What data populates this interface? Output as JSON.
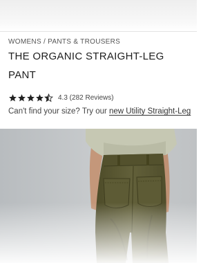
{
  "breadcrumb": "WOMENS / PANTS & TROUSERS",
  "product": {
    "title_line1": "THE ORGANIC STRAIGHT-LEG",
    "title_line2": "PANT",
    "rating": 4.3,
    "rating_text": "4.3 (282 Reviews)",
    "stars_filled": 4,
    "stars_half": 1
  },
  "size_help": {
    "prefix": "Can't find your size? Try our ",
    "link": "new Utility Straight-Leg"
  },
  "colors": {
    "pant_olive": "#5b5a33",
    "shirt_sage": "#c5c7b2",
    "skin": "#c89a7a",
    "background_gray": "#c3c6c9"
  },
  "icons": [
    "star-icon",
    "half-star-icon"
  ]
}
